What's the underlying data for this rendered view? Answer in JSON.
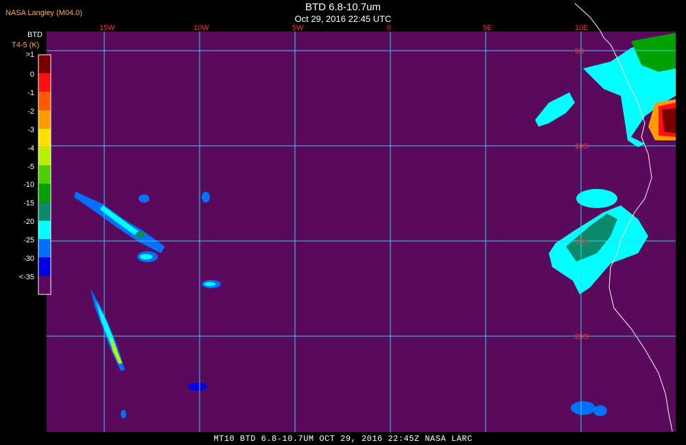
{
  "header": {
    "organization": "NASA Langley (M04.0)",
    "title": "BTD 6.8-10.7um",
    "subtitle": "Oct 29, 2016 22:45 UTC"
  },
  "legend": {
    "title": "BTD",
    "units": "T4-5 (K)",
    "entries": [
      {
        "label": ">1",
        "color": "#7a0000"
      },
      {
        "label": "0",
        "color": "#ff1010"
      },
      {
        "label": "-1",
        "color": "#ff5a00"
      },
      {
        "label": "-2",
        "color": "#ff9a00"
      },
      {
        "label": "-3",
        "color": "#ffe000"
      },
      {
        "label": "-4",
        "color": "#b8f000"
      },
      {
        "label": "-5",
        "color": "#4ed000"
      },
      {
        "label": "-10",
        "color": "#00a000"
      },
      {
        "label": "-15",
        "color": "#0a8a6a"
      },
      {
        "label": "-20",
        "color": "#00ffff"
      },
      {
        "label": "-25",
        "color": "#0070ff"
      },
      {
        "label": "-30",
        "color": "#0000e0"
      },
      {
        "label": "<-35",
        "color": "#5a0a5a"
      }
    ]
  },
  "map": {
    "background_color": "#5a0a5a",
    "grid_color": "#38d0ff",
    "coastline_color": "#ffffff",
    "longitude_labels": [
      "15W",
      "10W",
      "5W",
      "0",
      "5E",
      "10E"
    ],
    "latitude_labels": [
      "5S",
      "10S",
      "15S",
      "20S"
    ]
  },
  "footer": {
    "text": "MT10  BTD 6.8-10.7UM   OCT 29, 2016 22:45Z   NASA LARC"
  }
}
